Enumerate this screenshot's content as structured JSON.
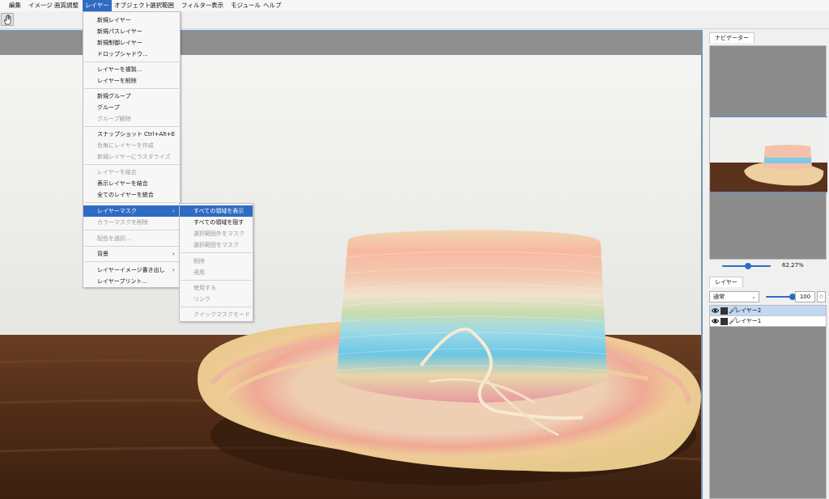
{
  "menubar": {
    "items": [
      "編集",
      "イメージ",
      "画質調整",
      "レイヤー",
      "オブジェクト",
      "選択範囲",
      "フィルター",
      "表示",
      "モジュール",
      "ヘルプ"
    ],
    "active_index": 3
  },
  "toolbar": {
    "tool_icon": "hand-icon"
  },
  "layer_menu": {
    "items": [
      {
        "label": "新規レイヤー",
        "enabled": true
      },
      {
        "label": "新規パスレイヤー",
        "enabled": true
      },
      {
        "label": "新規制御レイヤー",
        "enabled": true
      },
      {
        "label": "ドロップシャドウ...",
        "enabled": true
      },
      {
        "label": "レイヤーを複製...",
        "enabled": true
      },
      {
        "label": "レイヤーを削除",
        "enabled": true
      },
      {
        "label": "新規グループ",
        "enabled": true
      },
      {
        "label": "グループ",
        "enabled": true
      },
      {
        "label": "グループ解除",
        "enabled": false
      },
      {
        "label": "スナップショット",
        "shortcut": "Ctrl+Alt+E",
        "enabled": true
      },
      {
        "label": "色毎にレイヤーを作成",
        "enabled": false
      },
      {
        "label": "新規レイヤーにラスタライズ",
        "enabled": false
      },
      {
        "label": "レイヤーを結合",
        "enabled": false
      },
      {
        "label": "表示レイヤーを結合",
        "enabled": true
      },
      {
        "label": "全てのレイヤーを統合",
        "enabled": true
      },
      {
        "label": "レイヤーマスク",
        "enabled": true,
        "submenu": true,
        "highlighted": true
      },
      {
        "label": "カラーマスクを削除",
        "enabled": false
      },
      {
        "label": "配色を選択...",
        "enabled": false
      },
      {
        "label": "背景",
        "enabled": true,
        "submenu": true
      },
      {
        "label": "レイヤーイメージ書き出し",
        "enabled": true,
        "submenu": true
      },
      {
        "label": "レイヤープリント...",
        "enabled": true
      }
    ]
  },
  "mask_submenu": {
    "items": [
      {
        "label": "すべての領域を表示",
        "enabled": true,
        "highlighted": true
      },
      {
        "label": "すべての領域を隠す",
        "enabled": true
      },
      {
        "label": "選択範囲外をマスク",
        "enabled": false
      },
      {
        "label": "選択範囲をマスク",
        "enabled": false
      },
      {
        "label": "削除",
        "enabled": false
      },
      {
        "label": "適用",
        "enabled": false
      },
      {
        "label": "使用する",
        "enabled": false
      },
      {
        "label": "リンク",
        "enabled": false
      },
      {
        "label": "クイックマスクモード",
        "enabled": false
      }
    ]
  },
  "navigator": {
    "tab_label": "ナビゲーター",
    "zoom": "62.27%",
    "zoom_fraction": 0.35
  },
  "layers_panel": {
    "tab_label": "レイヤー",
    "blend_mode": "通常",
    "opacity": "100",
    "opacity_fraction": 1.0,
    "layers": [
      {
        "name": "レイヤー2",
        "selected": true
      },
      {
        "name": "レイヤー1",
        "selected": false
      }
    ]
  },
  "colors": {
    "accent": "#2f6bc4",
    "selection": "#c3d8f3"
  }
}
